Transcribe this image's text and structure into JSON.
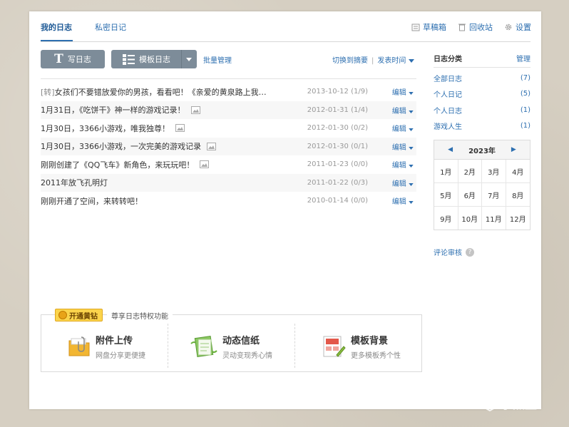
{
  "tabs": {
    "main": "我的日志",
    "private": "私密日记"
  },
  "header_links": {
    "drafts": "草稿箱",
    "recycle": "回收站",
    "settings": "设置"
  },
  "toolbar": {
    "write": "写日志",
    "template": "模板日志",
    "batch": "批量管理"
  },
  "sort": {
    "summary": "切换到摘要",
    "time": "发表时间"
  },
  "diaries": [
    {
      "tag": "[转]",
      "title": "女孩们不要错放爱你的男孩，看看吧！《亲爱的黄泉路上我…",
      "has_image": false,
      "date": "2013-10-12",
      "count": "(1/9)",
      "edit": "编辑"
    },
    {
      "tag": "",
      "title": "1月31日，《吃饼干》神一样的游戏记录！",
      "has_image": true,
      "date": "2012-01-31",
      "count": "(1/4)",
      "edit": "编辑"
    },
    {
      "tag": "",
      "title": "1月30日，3366小游戏，唯我独尊！",
      "has_image": true,
      "date": "2012-01-30",
      "count": "(0/2)",
      "edit": "编辑"
    },
    {
      "tag": "",
      "title": "1月30日，3366小游戏，一次完美的游戏记录",
      "has_image": true,
      "date": "2012-01-30",
      "count": "(0/1)",
      "edit": "编辑"
    },
    {
      "tag": "",
      "title": "刚刚创建了《QQ飞车》新角色，来玩玩吧！",
      "has_image": true,
      "date": "2011-01-23",
      "count": "(0/0)",
      "edit": "编辑"
    },
    {
      "tag": "",
      "title": "2011年放飞孔明灯",
      "has_image": false,
      "date": "2011-01-22",
      "count": "(0/3)",
      "edit": "编辑"
    },
    {
      "tag": "",
      "title": "刚刚开通了空间，来转转吧！",
      "has_image": false,
      "date": "2010-01-14",
      "count": "(0/0)",
      "edit": "编辑"
    }
  ],
  "sidebar": {
    "title": "日志分类",
    "manage": "管理",
    "categories": [
      {
        "name": "全部日志",
        "count": "(7)"
      },
      {
        "name": "个人日记",
        "count": "(5)"
      },
      {
        "name": "个人日志",
        "count": "(1)"
      },
      {
        "name": "游戏人生",
        "count": "(1)"
      }
    ]
  },
  "calendar": {
    "year": "2023年",
    "months": [
      "1月",
      "2月",
      "3月",
      "4月",
      "5月",
      "6月",
      "7月",
      "8月",
      "9月",
      "10月",
      "11月",
      "12月"
    ]
  },
  "review": {
    "label": "评论审核",
    "help": "?"
  },
  "vip": {
    "badge": "开通黄钻",
    "title": "尊享日志特权功能",
    "features": [
      {
        "title": "附件上传",
        "subtitle": "网盘分享更便捷"
      },
      {
        "title": "动态信纸",
        "subtitle": "灵动变现秀心情"
      },
      {
        "title": "模板背景",
        "subtitle": "更多模板秀个性"
      }
    ]
  },
  "watermark": "小黑盒",
  "colors": {
    "link": "#2d6fb0",
    "button": "#7d8c99",
    "vip_badge": "#fbd44c"
  }
}
